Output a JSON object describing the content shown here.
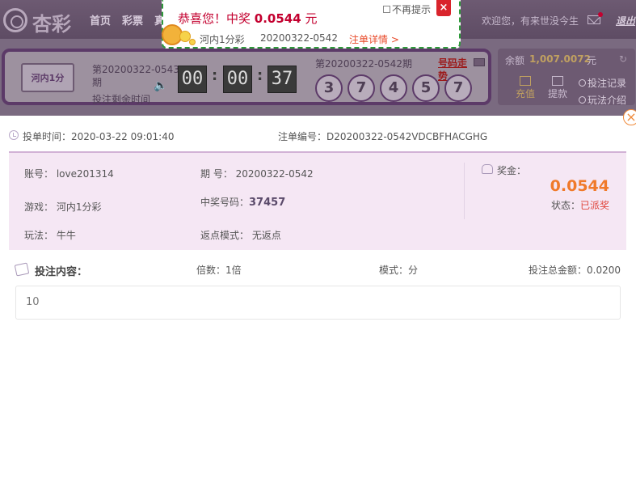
{
  "nav": {
    "logo": "杏彩",
    "items": [
      "首页",
      "彩票",
      "真"
    ],
    "welcome": "欢迎您，有来世没今生",
    "logout": "退出"
  },
  "game": {
    "logo": "河内1分",
    "current_issue": "第20200322-0543期",
    "countdown_label": "投注剩余时间",
    "countdown": [
      "00",
      "00",
      "37"
    ],
    "last_issue": "第20200322-0542期",
    "trend_link": "号码走势",
    "balls": [
      "3",
      "7",
      "4",
      "5",
      "7"
    ]
  },
  "balance": {
    "label": "余额",
    "amount": "1,007.0072",
    "unit": "元",
    "deposit": "充值",
    "withdraw": "提款",
    "bet_record": "投注记录",
    "play_intro": "玩法介绍"
  },
  "win_popup": {
    "prefix": "恭喜您！中奖 ",
    "amount": "0.0544",
    "suffix": " 元",
    "no_remind": "不再提示",
    "close": "×",
    "game": "河内1分彩",
    "issue": "20200322-0542",
    "detail_link": "注单详情 >"
  },
  "detail": {
    "close": "×",
    "bet_time_label": "投单时间：",
    "bet_time": "2020-03-22 09:01:40",
    "order_label": "注单编号：",
    "order_no": "D20200322-0542VDCBFHACGHG",
    "account_label": "账号：",
    "account": "love201314",
    "issue_label": "期 号：",
    "issue": "20200322-0542",
    "game_label": "游戏：",
    "game": "河内1分彩",
    "win_number_label": "中奖号码：",
    "win_number": "37457",
    "play_label": "玩法：",
    "play": "牛牛",
    "rebate_label": "返点模式：",
    "rebate": "无返点",
    "prize_label": "奖金：",
    "prize": "0.0544",
    "status_label": "状态：",
    "status": "已派奖",
    "bet_content_label": "投注内容：",
    "multiplier": "倍数：1倍",
    "mode": "模式：分",
    "total": "投注总金额：0.0200",
    "bet_content": "10"
  }
}
